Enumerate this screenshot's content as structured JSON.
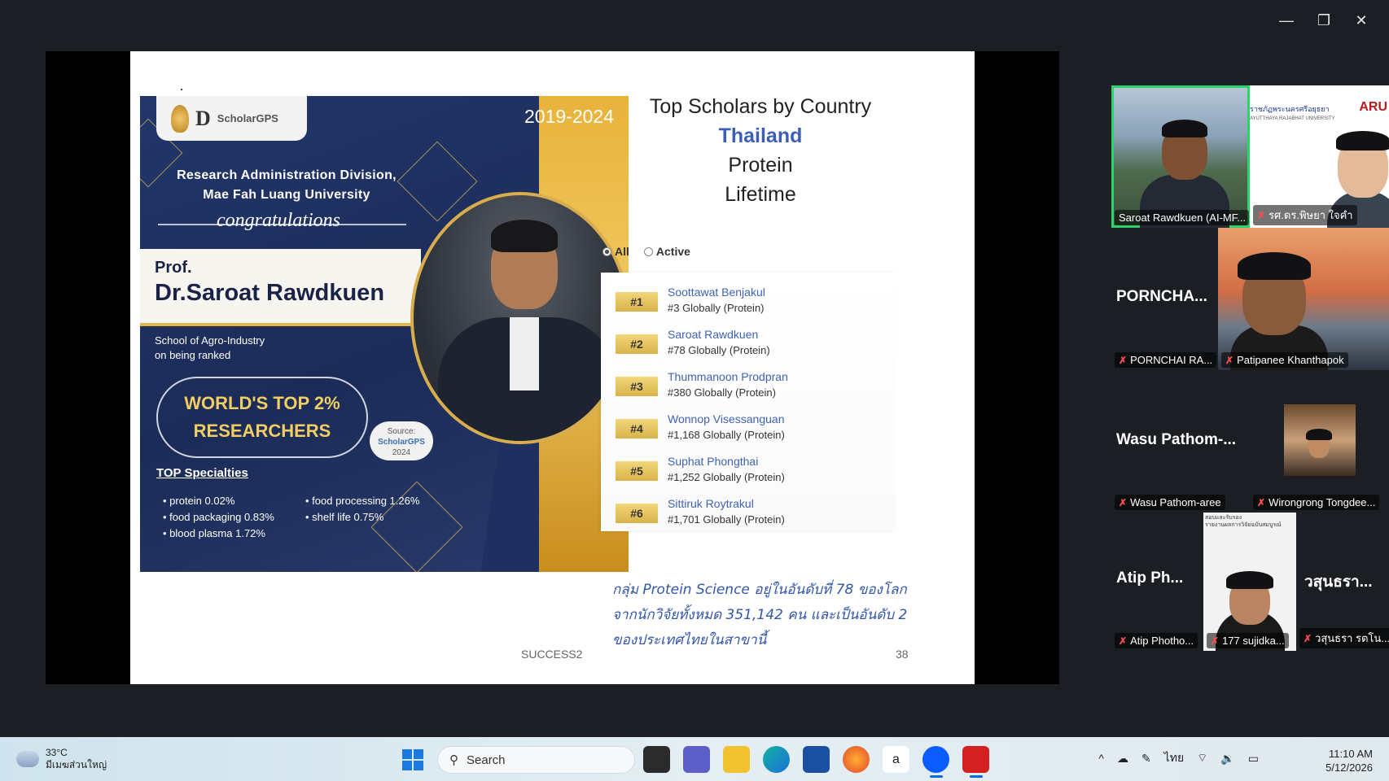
{
  "window": {
    "minimize": "—",
    "restore": "❐",
    "close": "✕"
  },
  "slide": {
    "poster": {
      "logo_text": "ScholarGPS",
      "years": "2019-2024",
      "division_line1": "Research Administration Division,",
      "division_line2": "Mae Fah Luang University",
      "congrats": "congratulations",
      "prof": "Prof.",
      "name": "Dr.Saroat Rawdkuen",
      "school_line1": "School of Agro-Industry",
      "school_line2": "on being ranked",
      "badge_line1": "WORLD'S TOP 2%",
      "badge_line2": "RESEARCHERS",
      "source_label": "Source:",
      "source_logo": "ScholarGPS",
      "source_year": "2024",
      "top_specialties": "TOP Specialties",
      "specialties": [
        "• protein 0.02%",
        "• food processing 1.26%",
        "• food packaging 0.83%",
        "• shelf life 0.75%",
        "• blood plasma 1.72%",
        ""
      ]
    },
    "top_scholars": {
      "title": "Top Scholars by Country",
      "country": "Thailand",
      "field": "Protein",
      "period": "Lifetime",
      "radio_all": "All",
      "radio_active": "Active",
      "ranks": [
        {
          "rank": "#1",
          "name": "Soottawat Benjakul",
          "global": "#3 Globally (Protein)"
        },
        {
          "rank": "#2",
          "name": "Saroat Rawdkuen",
          "global": "#78 Globally (Protein)"
        },
        {
          "rank": "#3",
          "name": "Thummanoon Prodpran",
          "global": "#380 Globally (Protein)"
        },
        {
          "rank": "#4",
          "name": "Wonnop Visessanguan",
          "global": "#1,168 Globally (Protein)"
        },
        {
          "rank": "#5",
          "name": "Suphat Phongthai",
          "global": "#1,252 Globally (Protein)"
        },
        {
          "rank": "#6",
          "name": "Sittiruk Roytrakul",
          "global": "#1,701 Globally (Protein)"
        }
      ]
    },
    "thai_note": "กลุ่ม Protein Science อยู่ในอันดับที่ 78 ของโลก จากนักวิจัยทั้งหมด 351,142 คน และเป็นอันดับ 2 ของประเทศไทยในสาขานี้",
    "footer_left": "SUCCESS2",
    "footer_page": "38"
  },
  "participants": {
    "t1": "Saroat Rawdkuen (AI-MF...",
    "t2": "รศ.ดร.พิษยา ใจคำ",
    "t2_banner": "ราชภัฏพระนครศรีอยุธยา",
    "t2_sub": "AYUTTHAYA RAJABHAT UNIVERSITY",
    "t2_logo": "ARU",
    "t3_big": "PORNCHA...",
    "t3": "PORNCHAI RA...",
    "t4": "Patipanee Khanthapok",
    "t5_big": "Wasu Pathom-...",
    "t5": "Wasu Pathom-aree",
    "t6": "Wirongrong Tongdee...",
    "t7_big": "Atip Ph...",
    "t7": "Atip Photho...",
    "t8": "177 sujidka...",
    "t8_caption": "สอบและรับรอง\nรายงานผลการวิจัยฉบับสมบูรณ์",
    "t9_big": "วสุนธรา...",
    "t9": "วสุนธรา รตโน..."
  },
  "taskbar": {
    "temp": "33°C",
    "weather": "มีเมฆส่วนใหญ่",
    "search": "Search",
    "lang": "ไทย",
    "time": "11:10 AM",
    "date": "5/12/2026",
    "tray_up": "^"
  }
}
